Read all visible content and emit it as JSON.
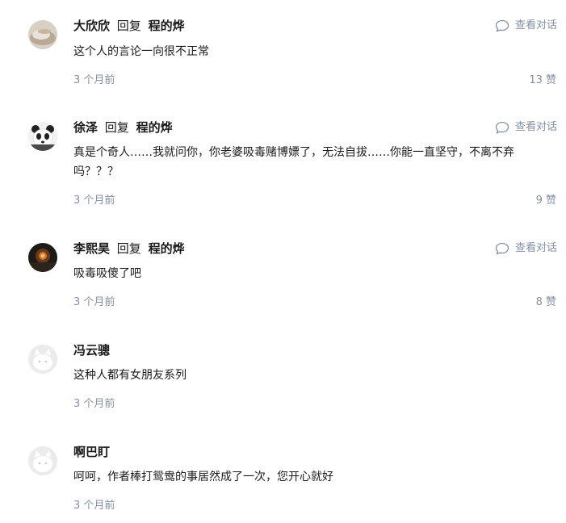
{
  "comments": [
    {
      "author": "大欣欣",
      "reply_word": "回复",
      "reply_to": "程的烨",
      "view_conversation": "查看对话",
      "content": "这个人的言论一向很不正常",
      "time": "3 个月前",
      "likes": "13 赞",
      "avatar_icon": "photo-avatar"
    },
    {
      "author": "徐泽",
      "reply_word": "回复",
      "reply_to": "程的烨",
      "view_conversation": "查看对话",
      "content": "真是个奇人……我就问你，你老婆吸毒赌博嫖了，无法自拔……你能一直坚守，不离不弃吗？？？",
      "time": "3 个月前",
      "likes": "9 赞",
      "avatar_icon": "panda-avatar"
    },
    {
      "author": "李熙昊",
      "reply_word": "回复",
      "reply_to": "程的烨",
      "view_conversation": "查看对话",
      "content": "吸毒吸傻了吧",
      "time": "3 个月前",
      "likes": "8 赞",
      "avatar_icon": "sunset-avatar"
    },
    {
      "author": "冯云骢",
      "content": "这种人都有女朋友系列",
      "time": "3 个月前",
      "avatar_icon": "default-avatar"
    },
    {
      "author": "啊巴盯",
      "content": "呵呵，作者棒打鸳鸯的事居然成了一次，您开心就好",
      "time": "3 个月前",
      "avatar_icon": "default-avatar"
    }
  ],
  "colors": {
    "text": "#1a1a1a",
    "meta": "#8590a6"
  }
}
